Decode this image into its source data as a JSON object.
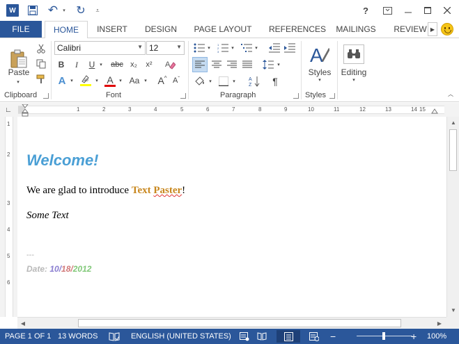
{
  "titlebar": {
    "app_logo": "W",
    "undo_glyph": "↶",
    "redo_glyph": "↻",
    "help_glyph": "?",
    "colors": {
      "accent": "#2b579a"
    }
  },
  "tabs": {
    "file": "FILE",
    "items": [
      "HOME",
      "INSERT",
      "DESIGN",
      "PAGE LAYOUT",
      "REFERENCES",
      "MAILINGS",
      "REVIEW"
    ],
    "active": "HOME"
  },
  "ribbon": {
    "clipboard": {
      "label": "Clipboard",
      "paste_label": "Paste"
    },
    "font": {
      "label": "Font",
      "font_name": "Calibri",
      "font_size": "12",
      "bold": "B",
      "italic": "I",
      "underline": "U",
      "strikethrough": "abc",
      "subscript": "x₂",
      "superscript": "x²",
      "grow": "A",
      "shrink": "A",
      "case": "Aa",
      "font_color_glyph": "A",
      "effects_glyph": "A"
    },
    "paragraph": {
      "label": "Paragraph",
      "pilcrow": "¶"
    },
    "styles": {
      "label": "Styles",
      "button_label": "Styles"
    },
    "editing": {
      "button_label": "Editing"
    }
  },
  "ruler": {
    "ticks": [
      "1",
      "2",
      "3",
      "4",
      "5",
      "6",
      "7",
      "8",
      "9",
      "10",
      "11",
      "12",
      "13",
      "14",
      "15"
    ],
    "vticks": [
      "1",
      "2",
      "3",
      "4",
      "5",
      "6"
    ]
  },
  "document": {
    "heading": "Welcome!",
    "line1_prefix": "We are glad to introduce ",
    "line1_brand_a": "Text ",
    "line1_brand_b": "Paster",
    "line1_suffix": "!",
    "line2": "Some Text",
    "separator": "---",
    "date_label": "Date: ",
    "date_month": "10",
    "date_slash1": "/",
    "date_day": "18",
    "date_slash2": "/",
    "date_year": "2012"
  },
  "statusbar": {
    "page": "PAGE 1 OF 1",
    "words": "13 WORDS",
    "language": "ENGLISH (UNITED STATES)",
    "zoom_minus": "−",
    "zoom_plus": "+",
    "zoom": "100%"
  }
}
